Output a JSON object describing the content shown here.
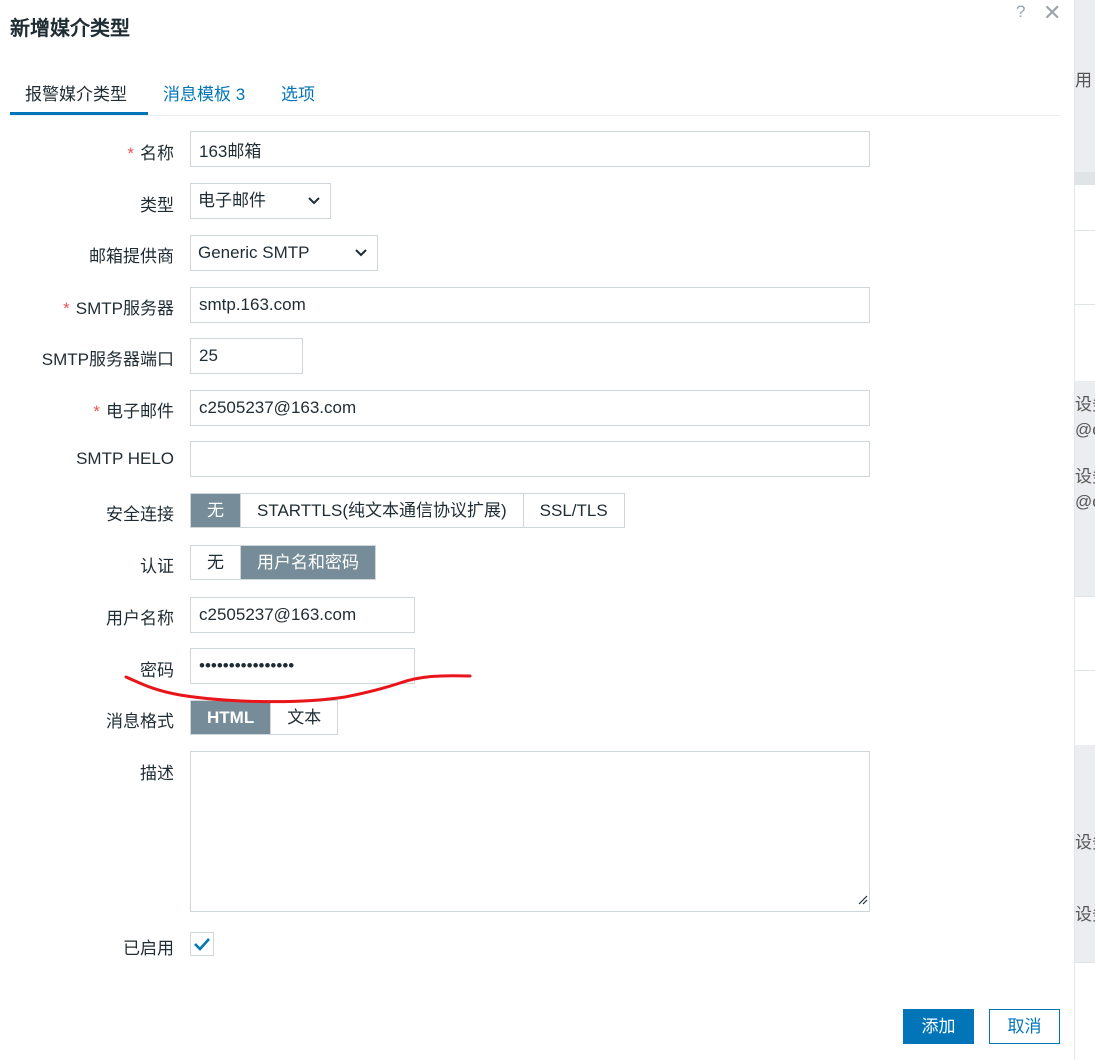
{
  "dialog": {
    "title": "新增媒介类型",
    "help_icon": "?",
    "close_icon": "✕"
  },
  "tabs": [
    {
      "label": "报警媒介类型",
      "active": true
    },
    {
      "label": "消息模板",
      "count": "3"
    },
    {
      "label": "选项"
    }
  ],
  "form": {
    "name_label": "名称",
    "name_value": "163邮箱",
    "type_label": "类型",
    "type_value": "电子邮件",
    "provider_label": "邮箱提供商",
    "provider_value": "Generic SMTP",
    "smtp_server_label": "SMTP服务器",
    "smtp_server_value": "smtp.163.com",
    "smtp_port_label": "SMTP服务器端口",
    "smtp_port_value": "25",
    "email_label": "电子邮件",
    "email_value": "c2505237@163.com",
    "helo_label": "SMTP HELO",
    "helo_value": "",
    "security_label": "安全连接",
    "security_options": [
      "无",
      "STARTTLS(纯文本通信协议扩展)",
      "SSL/TLS"
    ],
    "security_selected": "无",
    "auth_label": "认证",
    "auth_options": [
      "无",
      "用户名和密码"
    ],
    "auth_selected": "用户名和密码",
    "username_label": "用户名称",
    "username_value": "c2505237@163.com",
    "password_label": "密码",
    "password_value": "••••••••••••••••",
    "format_label": "消息格式",
    "format_options": [
      "HTML",
      "文本"
    ],
    "format_selected": "HTML",
    "description_label": "描述",
    "description_value": "",
    "enabled_label": "已启用",
    "enabled": true
  },
  "buttons": {
    "add": "添加",
    "cancel": "取消"
  },
  "background_page": {
    "fragments": [
      "用",
      "设务",
      "@c",
      "设务",
      "@c",
      "设务",
      "设务"
    ]
  },
  "colors": {
    "accent": "#0275b8",
    "segment_selected": "#768d99",
    "required": "#e45959",
    "annotation": "#e8151b"
  }
}
